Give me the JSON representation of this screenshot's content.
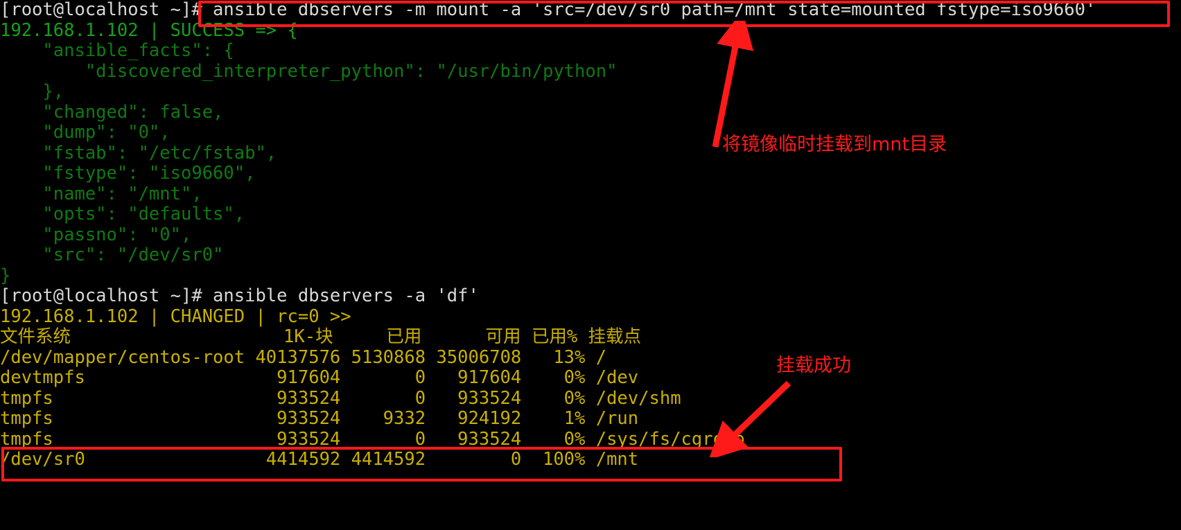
{
  "terminal": {
    "prompt": "[root@localhost ~]# ",
    "host_ip": "192.168.1.102",
    "lines": [
      {
        "id": "cmd1-prompt",
        "color": "white",
        "text": "[root@localhost ~]# "
      },
      {
        "id": "cmd1",
        "color": "white",
        "text": "ansible dbservers -m mount -a 'src=/dev/sr0 path=/mnt state=mounted fstype=iso9660'"
      },
      {
        "id": "res1-status",
        "color": "green",
        "text": "192.168.1.102 | SUCCESS => {"
      },
      {
        "id": "json-1",
        "color": "dgreen",
        "text": "    \"ansible_facts\": {"
      },
      {
        "id": "json-2",
        "color": "dgreen",
        "text": "        \"discovered_interpreter_python\": \"/usr/bin/python\""
      },
      {
        "id": "json-3",
        "color": "dgreen",
        "text": "    },"
      },
      {
        "id": "json-4",
        "color": "dgreen",
        "text": "    \"changed\": false,"
      },
      {
        "id": "json-5",
        "color": "dgreen",
        "text": "    \"dump\": \"0\","
      },
      {
        "id": "json-6",
        "color": "dgreen",
        "text": "    \"fstab\": \"/etc/fstab\","
      },
      {
        "id": "json-7",
        "color": "dgreen",
        "text": "    \"fstype\": \"iso9660\","
      },
      {
        "id": "json-8",
        "color": "dgreen",
        "text": "    \"name\": \"/mnt\","
      },
      {
        "id": "json-9",
        "color": "dgreen",
        "text": "    \"opts\": \"defaults\","
      },
      {
        "id": "json-10",
        "color": "dgreen",
        "text": "    \"passno\": \"0\","
      },
      {
        "id": "json-11",
        "color": "dgreen",
        "text": "    \"src\": \"/dev/sr0\""
      },
      {
        "id": "json-12",
        "color": "dgreen",
        "text": "}"
      },
      {
        "id": "cmd2",
        "color": "white",
        "text": "[root@localhost ~]# ansible dbservers -a 'df'"
      },
      {
        "id": "res2-status",
        "color": "yellow",
        "text": "192.168.1.102 | CHANGED | rc=0 >>"
      },
      {
        "id": "df-header",
        "color": "yellow",
        "text": "文件系统                    1K-块     已用      可用 已用% 挂载点"
      },
      {
        "id": "df-row-1",
        "color": "yellow",
        "text": "/dev/mapper/centos-root 40137576 5130868 35006708   13% /"
      },
      {
        "id": "df-row-2",
        "color": "yellow",
        "text": "devtmpfs                  917604       0   917604    0% /dev"
      },
      {
        "id": "df-row-3",
        "color": "yellow",
        "text": "tmpfs                     933524       0   933524    0% /dev/shm"
      },
      {
        "id": "df-row-4",
        "color": "yellow",
        "text": "tmpfs                     933524    9332   924192    1% /run"
      },
      {
        "id": "df-row-5",
        "color": "yellow",
        "text": "tmpfs                     933524       0   933524    0% /sys/fs/cgroup"
      },
      {
        "id": "df-row-6",
        "color": "yellow",
        "text": "/dev/sr0                 4414592 4414592        0  100% /mnt"
      }
    ],
    "df_table": {
      "headers": [
        "文件系统",
        "1K-块",
        "已用",
        "可用",
        "已用%",
        "挂载点"
      ],
      "rows": [
        [
          "/dev/mapper/centos-root",
          "40137576",
          "5130868",
          "35006708",
          "13%",
          "/"
        ],
        [
          "devtmpfs",
          "917604",
          "0",
          "917604",
          "0%",
          "/dev"
        ],
        [
          "tmpfs",
          "933524",
          "0",
          "933524",
          "0%",
          "/dev/shm"
        ],
        [
          "tmpfs",
          "933524",
          "9332",
          "924192",
          "1%",
          "/run"
        ],
        [
          "tmpfs",
          "933524",
          "0",
          "933524",
          "0%",
          "/sys/fs/cgroup"
        ],
        [
          "/dev/sr0",
          "4414592",
          "4414592",
          "0",
          "100%",
          "/mnt"
        ]
      ]
    }
  },
  "annotations": {
    "mount_note": "将镜像临时挂载到mnt目录",
    "success_note": "挂载成功",
    "color": "#ff1a1a"
  },
  "colors": {
    "background": "#000000",
    "prompt_text": "#d8d8d8",
    "success_green": "#17a017",
    "json_green": "#0f7a12",
    "changed_yellow": "#c9b000",
    "annotation_red": "#ff1a1a"
  }
}
